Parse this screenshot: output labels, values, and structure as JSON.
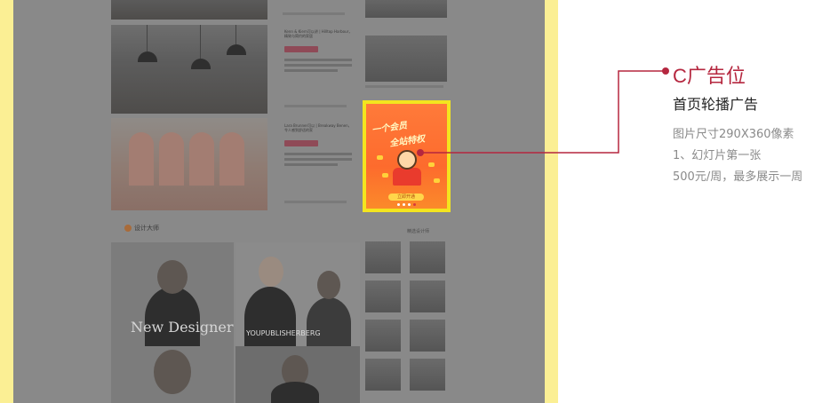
{
  "annotation": {
    "title": "C广告位",
    "subtitle": "首页轮播广告",
    "details": [
      "图片尺寸290X360像素",
      "1、幻灯片第一张",
      "500元/周，最多展示一周"
    ]
  },
  "colors": {
    "accent": "#b5273f",
    "frame": "#fbef94",
    "highlight": "#f3e51f",
    "overlay": "#898989"
  },
  "preview": {
    "articles": [
      {
        "title": "Kenn & Kiern可以讲 | Hilltop Harbour，精致与简约的家居"
      },
      {
        "title": "Lara Brunner可以 | Breakway Benen，令人感到舒适的家"
      }
    ],
    "ad": {
      "headline1": "一个会员",
      "headline2": "全站特权",
      "cta": "立即开通"
    },
    "section_title": "设计大师",
    "side_label": "精选设计师",
    "designer_captions": [
      "New Designer",
      "YOUPUBLISHERBERG"
    ]
  }
}
